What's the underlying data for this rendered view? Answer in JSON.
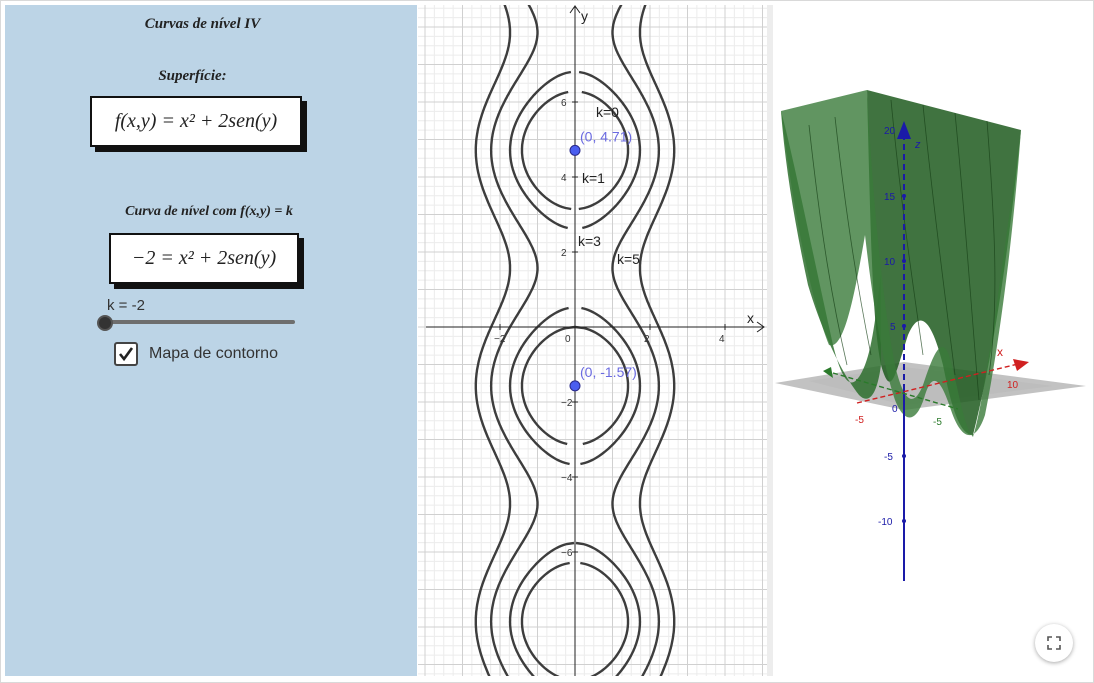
{
  "left_panel": {
    "title": "Curvas de nível IV",
    "surface_label": "Superfície:",
    "formula": "f(x,y) = x² + 2sen(y)",
    "curve_label": "Curva de nível com f(x,y) = k",
    "level_equation": "−2 = x² + 2sen(y)",
    "slider": {
      "label": "k = -2",
      "value": -2
    },
    "checkbox": {
      "label": "Mapa de contorno",
      "checked": true
    }
  },
  "graph2d": {
    "axis_x_label": "x",
    "axis_y_label": "y",
    "x_ticks": [
      "−2",
      "0",
      "2",
      "4"
    ],
    "y_ticks": [
      "6",
      "4",
      "2",
      "−2",
      "−4",
      "−6"
    ],
    "points": [
      {
        "label": "(0, 4.71)",
        "x": 0,
        "y": 4.71
      },
      {
        "label": "(0, -1.57)",
        "x": 0,
        "y": -1.57
      }
    ],
    "curve_labels": [
      "k=0",
      "k=1",
      "k=3",
      "k=5"
    ],
    "colors": {
      "curve": "#3d3d3d",
      "point": "#4a5ef0",
      "point_label": "#6a6ae0"
    }
  },
  "graph3d": {
    "z_ticks": [
      "20",
      "15",
      "10",
      "5",
      "0",
      "-5",
      "-10"
    ],
    "axis_labels": {
      "x": "x",
      "z": "z"
    },
    "extra_ticks": [
      "-5",
      "-5",
      "10"
    ],
    "colors": {
      "surface": "#2f6b2f",
      "z_axis": "#1a1aa8",
      "x_axis": "#d02020"
    }
  },
  "icons": {
    "fullscreen": "fullscreen-icon"
  }
}
